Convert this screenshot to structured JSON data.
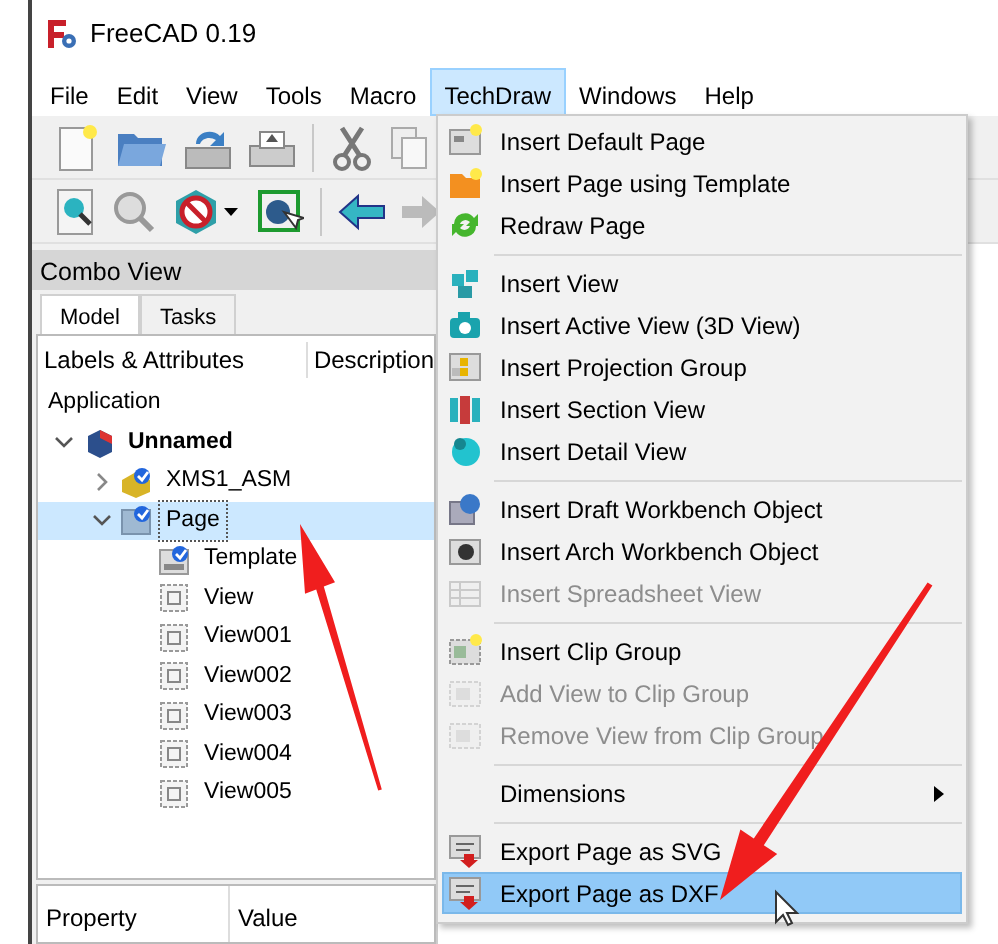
{
  "window": {
    "title": "FreeCAD 0.19"
  },
  "menu_bar": [
    {
      "label": "File",
      "selected": false
    },
    {
      "label": "Edit",
      "selected": false
    },
    {
      "label": "View",
      "selected": false
    },
    {
      "label": "Tools",
      "selected": false
    },
    {
      "label": "Macro",
      "selected": false
    },
    {
      "label": "TechDraw",
      "selected": true
    },
    {
      "label": "Windows",
      "selected": false
    },
    {
      "label": "Help",
      "selected": false
    }
  ],
  "combo_view": {
    "title": "Combo View",
    "tabs": [
      {
        "label": "Model",
        "selected": true
      },
      {
        "label": "Tasks",
        "selected": false
      }
    ],
    "tree_columns": [
      "Labels & Attributes",
      "Description"
    ],
    "tree": [
      {
        "label": "Application",
        "selected": false,
        "children": [
          {
            "label": "Unnamed",
            "kind": "document",
            "selected": false,
            "expanded": true,
            "children": [
              {
                "label": "XMS1_ASM",
                "kind": "part",
                "selected": false,
                "expanded": false
              },
              {
                "label": "Page",
                "kind": "page",
                "selected": true,
                "expanded": true,
                "children": [
                  {
                    "label": "Template",
                    "kind": "template",
                    "selected": false
                  },
                  {
                    "label": "View",
                    "kind": "view",
                    "selected": false
                  },
                  {
                    "label": "View001",
                    "kind": "view",
                    "selected": false
                  },
                  {
                    "label": "View002",
                    "kind": "view",
                    "selected": false
                  },
                  {
                    "label": "View003",
                    "kind": "view",
                    "selected": false
                  },
                  {
                    "label": "View004",
                    "kind": "view",
                    "selected": false
                  },
                  {
                    "label": "View005",
                    "kind": "view",
                    "selected": false
                  }
                ]
              }
            ]
          }
        ]
      }
    ],
    "property_columns": [
      "Property",
      "Value"
    ]
  },
  "techdraw_menu": [
    {
      "kind": "item",
      "label": "Insert Default Page",
      "disabled": false,
      "selected": false
    },
    {
      "kind": "item",
      "label": "Insert Page using Template",
      "disabled": false,
      "selected": false
    },
    {
      "kind": "item",
      "label": "Redraw Page",
      "disabled": false,
      "selected": false
    },
    {
      "kind": "separator"
    },
    {
      "kind": "item",
      "label": "Insert View",
      "disabled": false,
      "selected": false
    },
    {
      "kind": "item",
      "label": "Insert Active View (3D View)",
      "disabled": false,
      "selected": false
    },
    {
      "kind": "item",
      "label": "Insert Projection Group",
      "disabled": false,
      "selected": false
    },
    {
      "kind": "item",
      "label": "Insert Section View",
      "disabled": false,
      "selected": false
    },
    {
      "kind": "item",
      "label": "Insert Detail View",
      "disabled": false,
      "selected": false
    },
    {
      "kind": "separator"
    },
    {
      "kind": "item",
      "label": "Insert Draft Workbench Object",
      "disabled": false,
      "selected": false
    },
    {
      "kind": "item",
      "label": "Insert Arch Workbench Object",
      "disabled": false,
      "selected": false
    },
    {
      "kind": "item",
      "label": "Insert Spreadsheet View",
      "disabled": true,
      "selected": false
    },
    {
      "kind": "separator"
    },
    {
      "kind": "item",
      "label": "Insert Clip Group",
      "disabled": false,
      "selected": false
    },
    {
      "kind": "item",
      "label": "Add View to Clip Group",
      "disabled": true,
      "selected": false
    },
    {
      "kind": "item",
      "label": "Remove View from Clip Group",
      "disabled": true,
      "selected": false
    },
    {
      "kind": "separator"
    },
    {
      "kind": "submenu",
      "label": "Dimensions",
      "disabled": false,
      "selected": false
    },
    {
      "kind": "separator"
    },
    {
      "kind": "item",
      "label": "Export Page as SVG",
      "disabled": false,
      "selected": false
    },
    {
      "kind": "item",
      "label": "Export Page as DXF",
      "disabled": false,
      "selected": true
    }
  ]
}
